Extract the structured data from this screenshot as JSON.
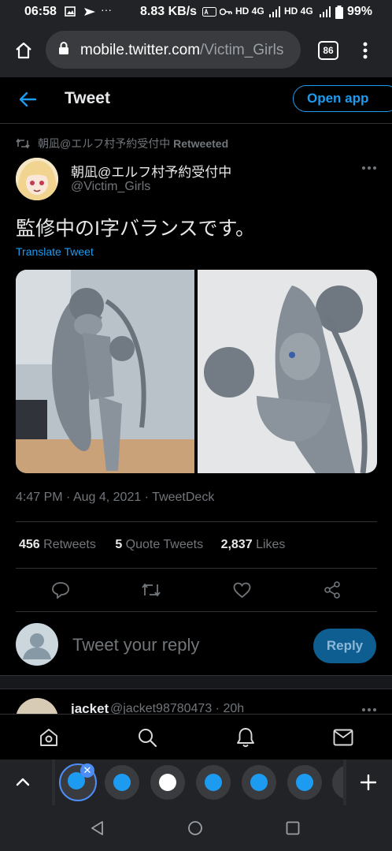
{
  "status_bar": {
    "time": "06:58",
    "speed": "8.83 KB/s",
    "network_1": "HD 4G",
    "network_2": "HD 4G",
    "battery": "99%"
  },
  "browser": {
    "url_domain": "mobile.twitter.com",
    "url_path": "/Victim_Girls",
    "tab_count": "86"
  },
  "header": {
    "title": "Tweet",
    "open_app_label": "Open app"
  },
  "tweet": {
    "retweeted_by": "朝凪@エルフ村予約受付中",
    "retweeted_label": "Retweeted",
    "display_name": "朝凪@エルフ村予約受付中",
    "handle": "@Victim_Girls",
    "text": "監修中のI字バランスです。",
    "translate_label": "Translate Tweet",
    "time": "4:47 PM",
    "date": "Aug 4, 2021",
    "source": "TweetDeck",
    "retweets_count": "456",
    "retweets_label": "Retweets",
    "quotes_count": "5",
    "quotes_label": "Quote Tweets",
    "likes_count": "2,837",
    "likes_label": "Likes"
  },
  "reply_box": {
    "placeholder": "Tweet your reply",
    "button_label": "Reply"
  },
  "next_reply": {
    "name": "jacket",
    "handle": "@jacket98780473",
    "age": "20h"
  },
  "colors": {
    "accent": "#1d9bf0",
    "background": "#000000",
    "muted_text": "#71767b"
  }
}
